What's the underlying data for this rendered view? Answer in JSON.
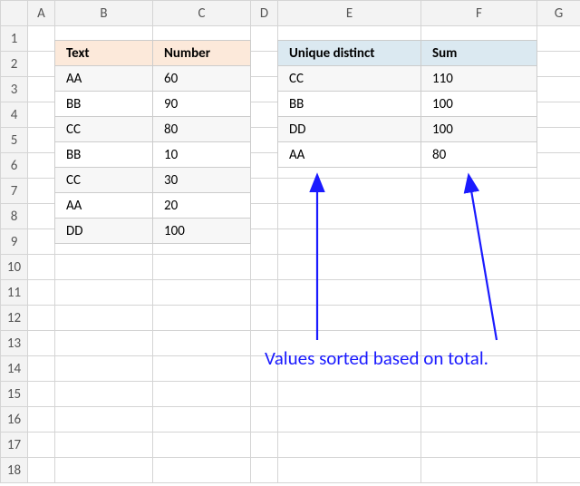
{
  "columns": [
    "A",
    "B",
    "C",
    "D",
    "E",
    "F",
    "G"
  ],
  "col_widths": {
    "corner": 30,
    "A": 30,
    "B": 108,
    "C": 108,
    "D": 30,
    "E": 158,
    "F": 128,
    "G": 48
  },
  "rows": [
    "1",
    "2",
    "3",
    "4",
    "5",
    "6",
    "7",
    "8",
    "9",
    "10",
    "11",
    "12",
    "13",
    "14",
    "15",
    "16",
    "17",
    "18"
  ],
  "left_table": {
    "headers": [
      "Text",
      "Number"
    ],
    "rows": [
      [
        "AA",
        "60"
      ],
      [
        "BB",
        "90"
      ],
      [
        "CC",
        "80"
      ],
      [
        "BB",
        "10"
      ],
      [
        "CC",
        "30"
      ],
      [
        "AA",
        "20"
      ],
      [
        "DD",
        "100"
      ]
    ]
  },
  "right_table": {
    "headers": [
      "Unique distinct",
      "Sum"
    ],
    "rows": [
      [
        "CC",
        "110"
      ],
      [
        "BB",
        "100"
      ],
      [
        "DD",
        "100"
      ],
      [
        "AA",
        "80"
      ]
    ]
  },
  "annotation_text": "Values sorted based on total.",
  "chart_data": {
    "type": "table",
    "tables": [
      {
        "name": "source",
        "headers": [
          "Text",
          "Number"
        ],
        "rows": [
          [
            "AA",
            60
          ],
          [
            "BB",
            90
          ],
          [
            "CC",
            80
          ],
          [
            "BB",
            10
          ],
          [
            "CC",
            30
          ],
          [
            "AA",
            20
          ],
          [
            "DD",
            100
          ]
        ]
      },
      {
        "name": "summary",
        "headers": [
          "Unique distinct",
          "Sum"
        ],
        "rows": [
          [
            "CC",
            110
          ],
          [
            "BB",
            100
          ],
          [
            "DD",
            100
          ],
          [
            "AA",
            80
          ]
        ]
      }
    ]
  }
}
